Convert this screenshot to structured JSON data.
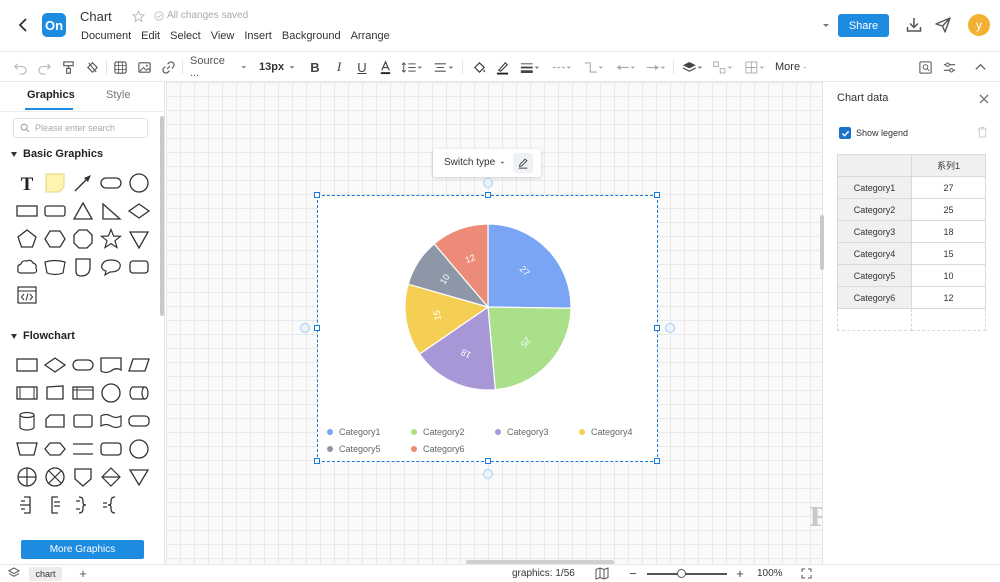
{
  "colors": {
    "brand": "#1d8ce0",
    "primary": "#1a7ad9",
    "avatar": "#f2b133",
    "checkbox": "#1a73c9"
  },
  "header": {
    "logo_text": "On",
    "title": "Chart",
    "save_status": "All changes saved",
    "menu": [
      "Document",
      "Edit",
      "Select",
      "View",
      "Insert",
      "Background",
      "Arrange"
    ],
    "share_label": "Share",
    "avatar_letter": "y"
  },
  "toolbar": {
    "font": "Source ...",
    "font_size": "13px",
    "more": "More",
    "icons": [
      "undo-icon",
      "redo-icon",
      "format-painter-icon",
      "clear-format-icon",
      "grid-icon",
      "image-icon",
      "link-icon",
      "font-select",
      "font-size-select",
      "bold-icon",
      "italic-icon",
      "underline-icon",
      "font-color-icon",
      "line-spacing-icon",
      "align-icon",
      "fill-color-icon",
      "line-color-icon",
      "line-width-icon",
      "line-style-icon",
      "connector-icon",
      "start-arrow-icon",
      "end-arrow-icon",
      "layer-icon",
      "position-icon",
      "group-icon",
      "more-button",
      "search-replace-icon",
      "settings-icon",
      "collapse-icon"
    ]
  },
  "left_panel": {
    "tabs": [
      "Graphics",
      "Style"
    ],
    "search_placeholder": "Please enter search",
    "sections": [
      {
        "title": "Basic Graphics",
        "shapes": [
          "text",
          "note",
          "line",
          "rounded-rectangle",
          "circle",
          "rectangle",
          "rect-rounded-small",
          "triangle",
          "right-triangle",
          "diamond",
          "pentagon",
          "hexagon",
          "octagon",
          "star",
          "inverted-triangle",
          "cloud",
          "trapezoid",
          "tag",
          "speech-bubble",
          "folded-rect",
          "code-block"
        ]
      },
      {
        "title": "Flowchart",
        "shapes": [
          "process",
          "decision",
          "terminator",
          "document",
          "data",
          "predefined-process",
          "manual-input",
          "internal-storage",
          "connector",
          "direct-access",
          "database",
          "card",
          "display",
          "punched-tape",
          "stored-data",
          "manual-operation",
          "preparation",
          "separator",
          "delay",
          "merge-circle",
          "summing-junction",
          "or-circle",
          "off-page",
          "sort",
          "extract",
          "bracket-right",
          "bracket-left",
          "brace-right",
          "brace-left"
        ]
      }
    ],
    "more_graphics": "More Graphics"
  },
  "canvas": {
    "switch_type": "Switch type",
    "watermark": "ProcessOn"
  },
  "chart_data": {
    "type": "pie",
    "categories": [
      "Category1",
      "Category2",
      "Category3",
      "Category4",
      "Category5",
      "Category6"
    ],
    "values": [
      27,
      25,
      18,
      15,
      10,
      12
    ],
    "colors": [
      "#7aa5f5",
      "#a9e089",
      "#a897d6",
      "#f5cf54",
      "#8d97a8",
      "#ec8c78"
    ],
    "series": [
      {
        "name": "系列1",
        "values": [
          27,
          25,
          18,
          15,
          10,
          12
        ]
      }
    ],
    "data_labels": true,
    "legend": "bottom"
  },
  "right_panel": {
    "title": "Chart data",
    "show_legend_label": "Show legend",
    "show_legend": true,
    "table": {
      "header": [
        "",
        "系列1"
      ],
      "rows": [
        [
          "Category1",
          "27"
        ],
        [
          "Category2",
          "25"
        ],
        [
          "Category3",
          "18"
        ],
        [
          "Category4",
          "15"
        ],
        [
          "Category5",
          "10"
        ],
        [
          "Category6",
          "12"
        ]
      ]
    }
  },
  "status_bar": {
    "page_tab": "chart",
    "graphics_label": "graphics:",
    "graphics_count": "1/56",
    "zoom": "100%",
    "zoom_level": 0.42
  }
}
